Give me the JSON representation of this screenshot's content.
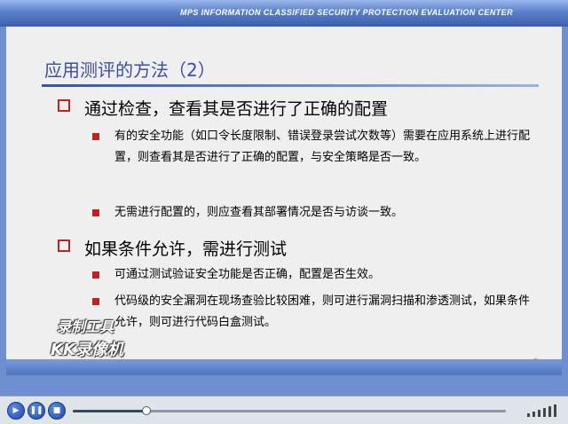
{
  "banner": {
    "subtitle": "MPS INFORMATION CLASSIFIED SECURITY PROTECTION EVALUATION CENTER"
  },
  "slide": {
    "title": "应用测评的方法（2）",
    "page_number": "8",
    "sections": [
      {
        "heading": "通过检查，查看其是否进行了正确的配置",
        "bullets": [
          "有的安全功能（如口令长度限制、错误登录尝试次数等）需要在应用系统上进行配置，则查看其是否进行了正确的配置，与安全策略是否一致。",
          "无需进行配置的，则应查看其部署情况是否与访谈一致。"
        ]
      },
      {
        "heading": "如果条件允许，需进行测试",
        "bullets": [
          "可通过测试验证安全功能是否正确，配置是否生效。",
          "代码级的安全漏洞在现场查验比较困难，则可进行漏洞扫描和渗透测试，如果条件允许，则可进行代码白盒测试。"
        ]
      }
    ]
  },
  "watermark": {
    "line1": "录制工具",
    "line2": "KK录像机"
  },
  "player": {
    "play_icon": "play-icon",
    "pause_icon": "pause-icon",
    "stop_icon": "stop-icon",
    "progress": 0.17,
    "colors": {
      "button": "#2a55b8",
      "bar": "#8a95a8"
    }
  }
}
